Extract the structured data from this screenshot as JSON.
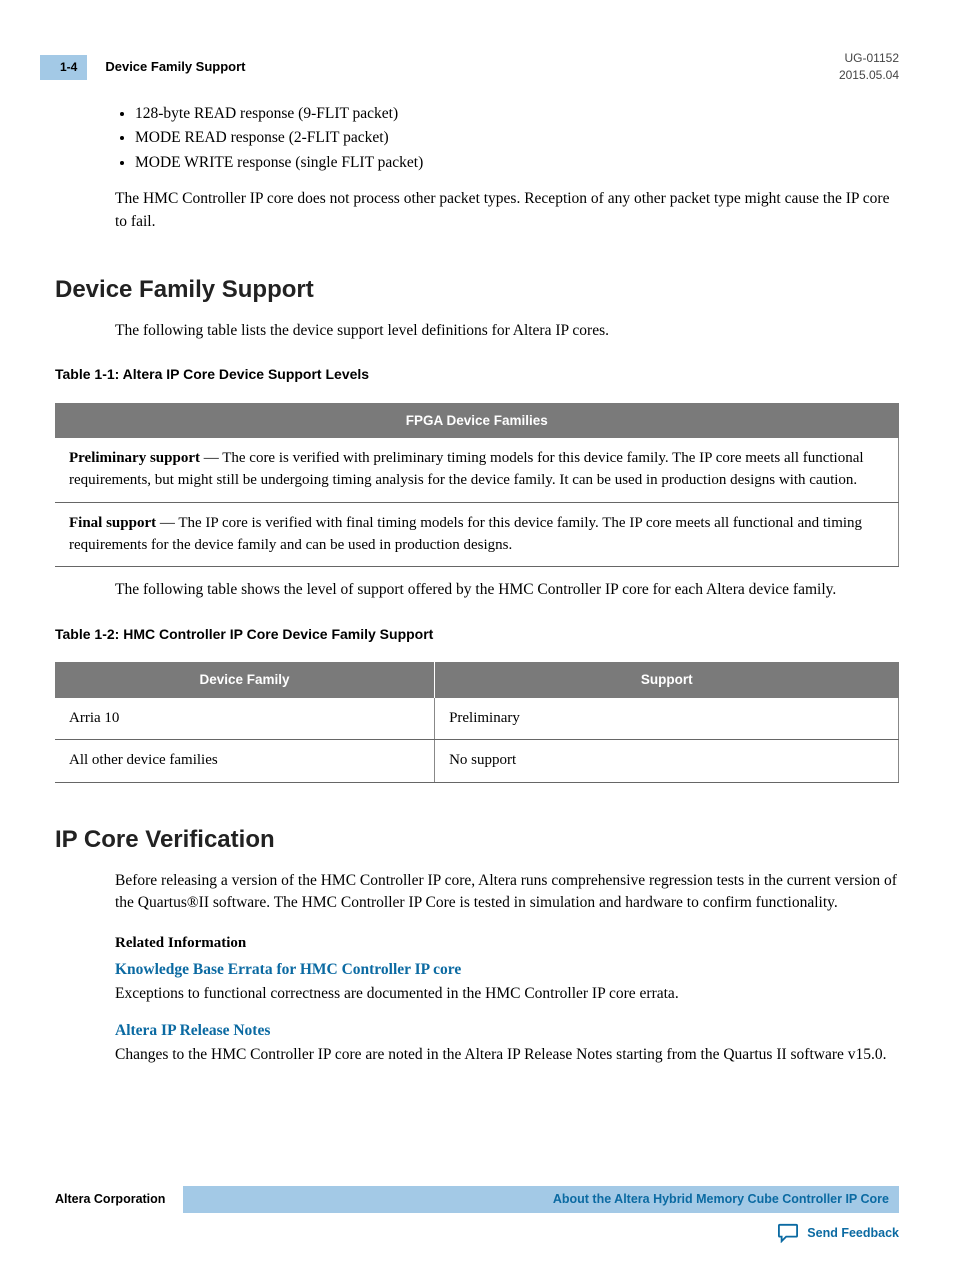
{
  "header": {
    "page_num": "1-4",
    "section_title": "Device Family Support",
    "doc_id": "UG-01152",
    "date": "2015.05.04"
  },
  "intro": {
    "bullets": [
      "128-byte READ response (9-FLIT packet)",
      "MODE READ response (2-FLIT packet)",
      "MODE WRITE response (single FLIT packet)"
    ],
    "para": "The HMC Controller IP core does not process other packet types. Reception of any other packet type might cause the IP core to fail."
  },
  "section1": {
    "title": "Device Family Support",
    "para1": "The following table lists the device support level definitions for Altera IP cores.",
    "table1_caption": "Table 1-1: Altera IP Core Device Support Levels",
    "table1_header": "FPGA Device Families",
    "table1_row1_bold": "Preliminary support",
    "table1_row1_rest": " — The core is verified with preliminary timing models for this device family. The IP core meets all functional requirements, but might still be undergoing timing analysis for the device family. It can be used in production designs with caution.",
    "table1_row2_bold": "Final support",
    "table1_row2_rest": " — The IP core is verified with final timing models for this device family. The IP core meets all functional and timing requirements for the device family and can be used in production designs.",
    "para2": "The following table shows the level of support offered by the HMC Controller IP core for each Altera device family.",
    "table2_caption": "Table 1-2: HMC Controller IP Core Device Family Support",
    "table2_headers": [
      "Device Family",
      "Support"
    ],
    "table2_rows": [
      [
        "Arria 10",
        "Preliminary"
      ],
      [
        "All other device families",
        "No support"
      ]
    ]
  },
  "section2": {
    "title": "IP Core Verification",
    "para": "Before releasing a version of the HMC Controller IP core, Altera runs comprehensive regression tests in the current version of the Quartus®II software. The HMC Controller IP Core is tested in simulation and hardware to confirm functionality.",
    "related_head": "Related Information",
    "link1": "Knowledge Base Errata for HMC Controller IP core",
    "link1_desc": "Exceptions to functional correctness are documented in the HMC Controller IP core errata.",
    "link2": "Altera IP Release Notes",
    "link2_desc": "Changes to the HMC Controller IP core are noted in the Altera IP Release Notes starting from the Quartus II software v15.0."
  },
  "footer": {
    "corp": "Altera Corporation",
    "bar_text": "About the Altera Hybrid Memory Cube Controller IP Core",
    "feedback": "Send Feedback"
  }
}
